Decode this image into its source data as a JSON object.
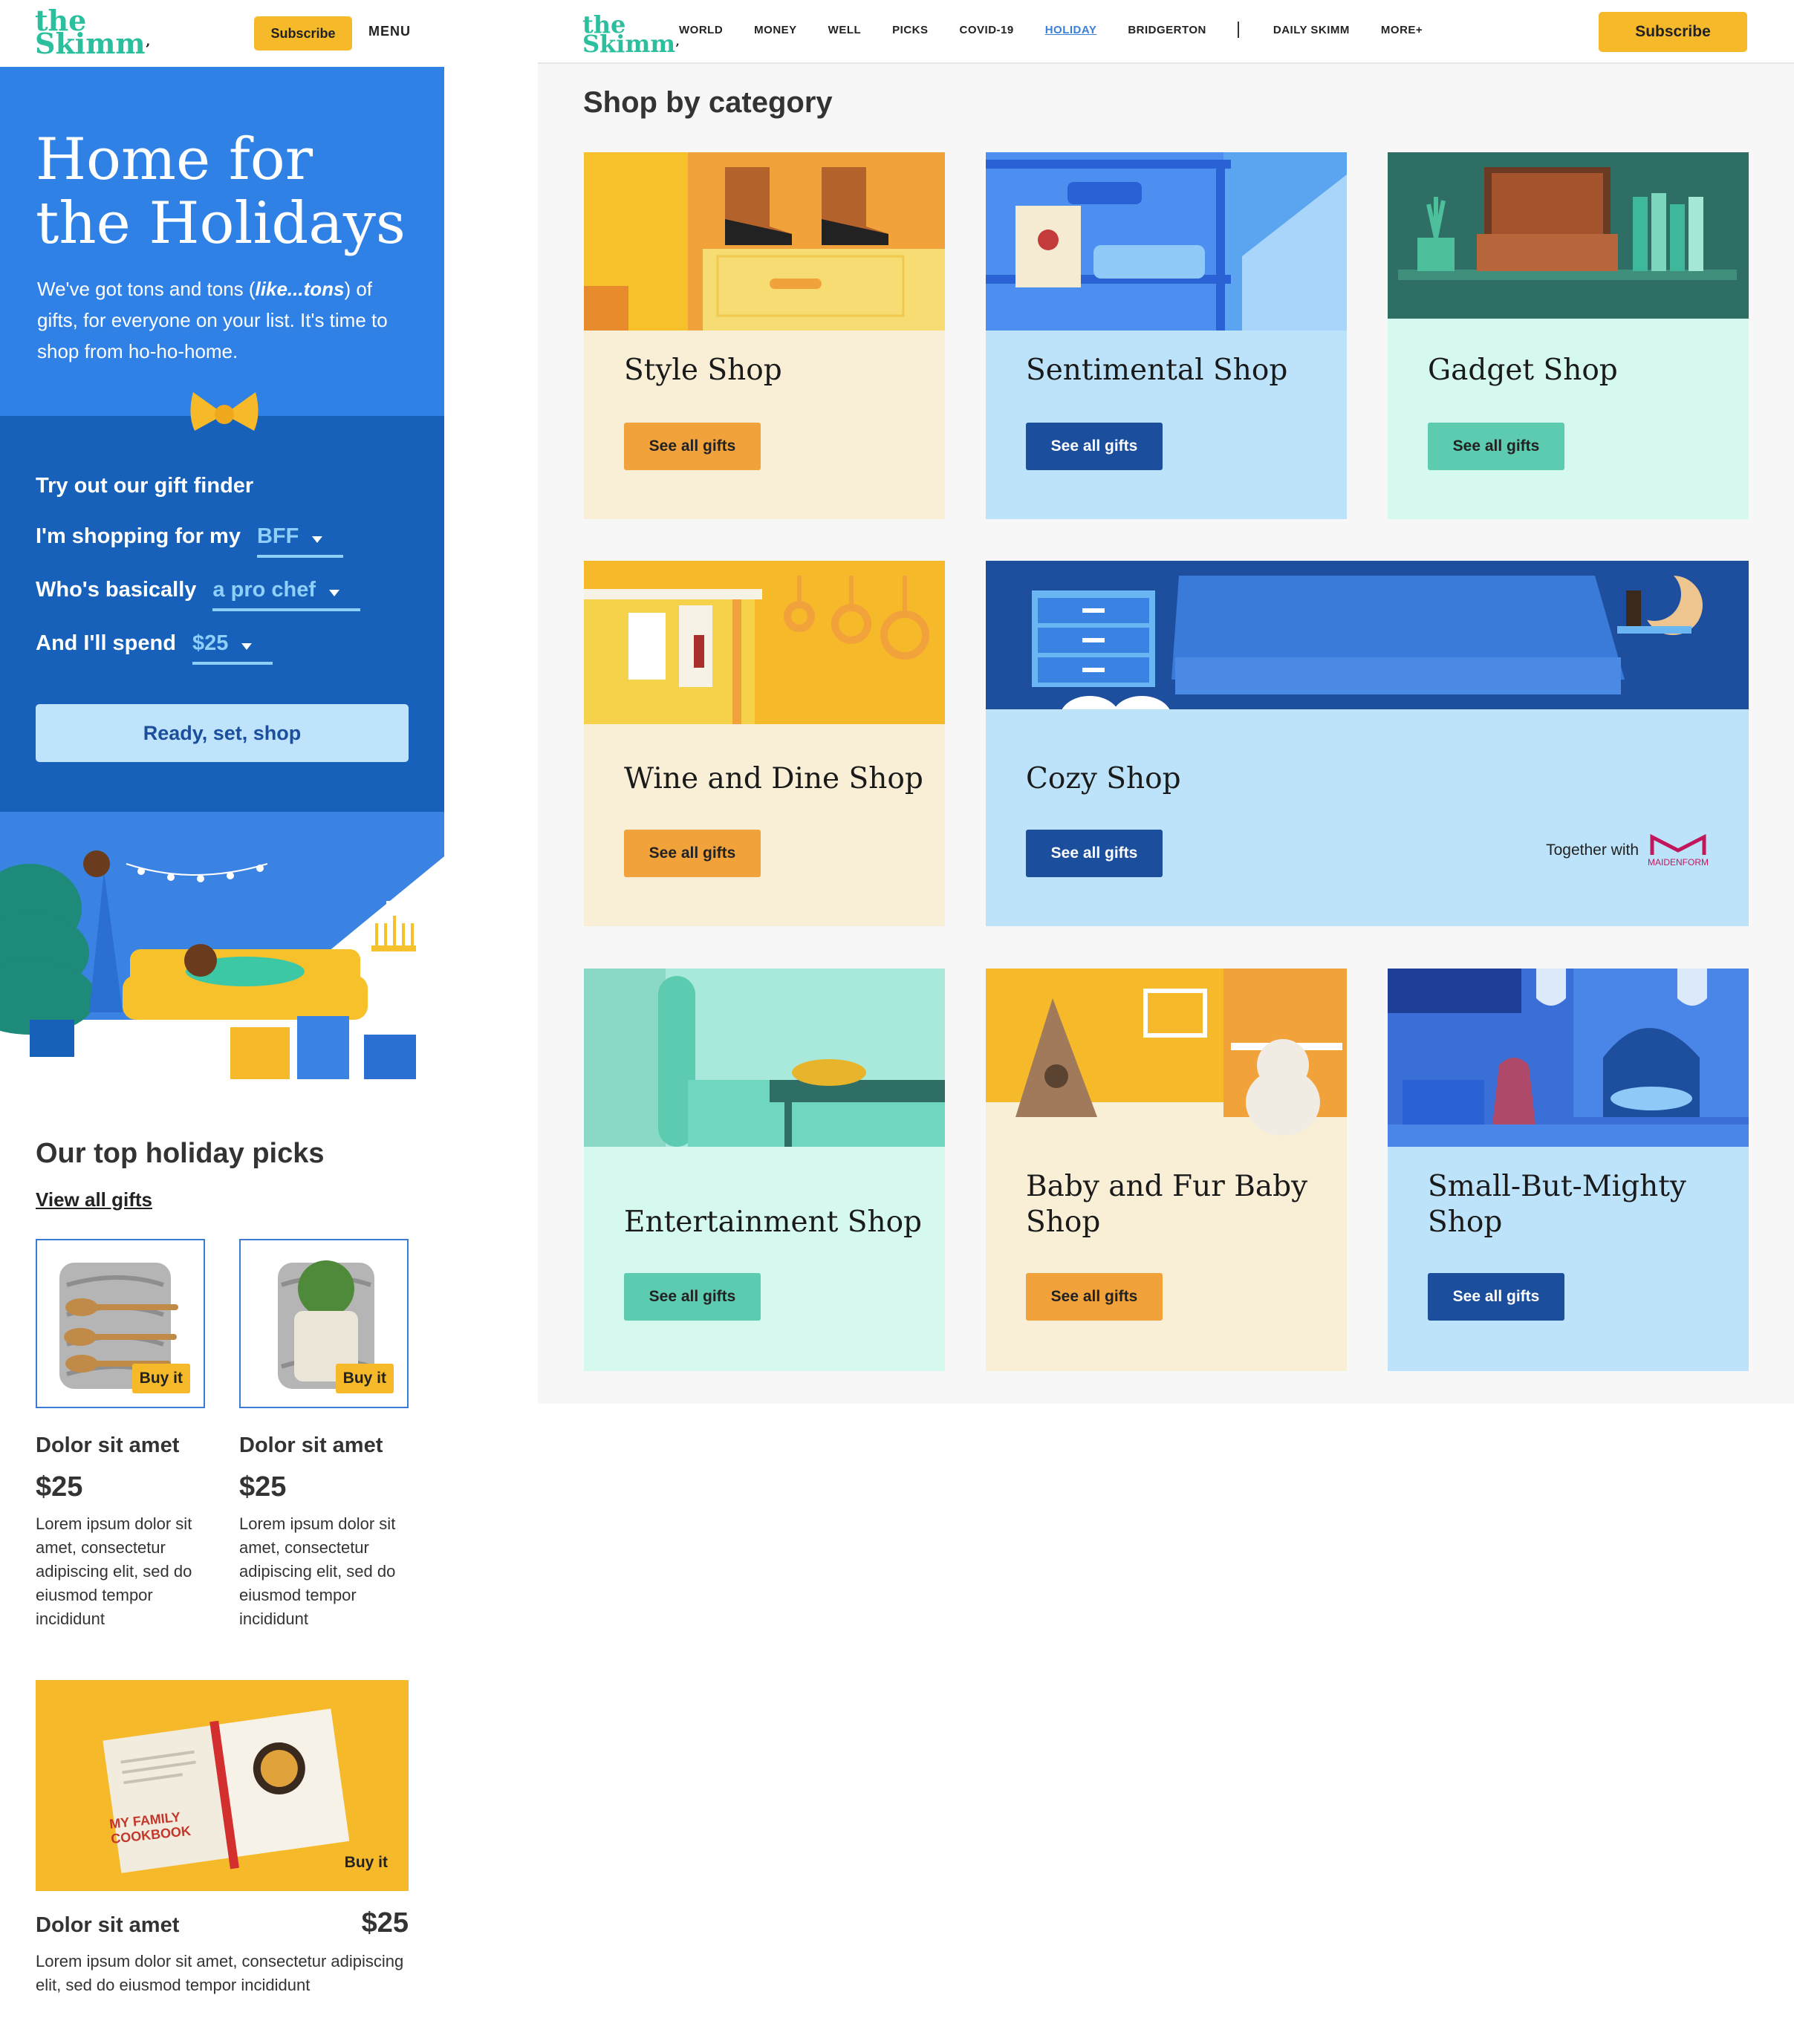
{
  "mobile": {
    "logo": {
      "line1": "the",
      "line2": "Skimm"
    },
    "subscribe_label": "Subscribe",
    "menu_label": "MENU",
    "hero": {
      "title": "Home for the Holidays",
      "intro_before": "We've got tons and tons (",
      "intro_emph": "like...tons",
      "intro_after": ") of gifts, for everyone on your list. It's time to shop from ho-ho-home."
    },
    "finder": {
      "title": "Try out our gift finder",
      "rows": [
        {
          "label": "I'm shopping for my",
          "value": "BFF"
        },
        {
          "label": "Who's basically",
          "value": "a pro chef"
        },
        {
          "label": "And I'll spend",
          "value": "$25"
        }
      ],
      "cta": "Ready, set, shop"
    },
    "picks": {
      "title": "Our top holiday picks",
      "view_all": "View all gifts",
      "buy_label": "Buy it",
      "items": [
        {
          "name": "Dolor sit amet",
          "price": "$25",
          "desc": "Lorem ipsum dolor sit amet, consectetur adipiscing elit, sed do eiusmod tempor incididunt"
        },
        {
          "name": "Dolor sit amet",
          "price": "$25",
          "desc": "Lorem ipsum dolor sit amet, consectetur adipiscing elit, sed do eiusmod tempor incididunt"
        }
      ],
      "featured": {
        "name": "Dolor sit amet",
        "price": "$25",
        "desc": "Lorem ipsum dolor sit amet, consectetur adipiscing elit, sed do eiusmod tempor incididunt",
        "book_line1": "MY FAMILY",
        "book_line2": "COOKBOOK"
      }
    }
  },
  "desktop": {
    "logo": {
      "line1": "the",
      "line2": "Skimm"
    },
    "nav": [
      "WORLD",
      "MONEY",
      "WELL",
      "PICKS",
      "COVID-19",
      "HOLIDAY",
      "BRIDGERTON",
      "DAILY SKIMM",
      "MORE+"
    ],
    "active_nav": "HOLIDAY",
    "subscribe_label": "Subscribe",
    "section_title": "Shop by category",
    "button_label": "See all gifts",
    "sponsor": {
      "text": "Together with",
      "brand": "MAIDENFORM"
    },
    "categories": [
      {
        "title": "Style Shop"
      },
      {
        "title": "Sentimental Shop"
      },
      {
        "title": "Gadget Shop"
      },
      {
        "title": "Wine and Dine Shop"
      },
      {
        "title": "Cozy Shop"
      },
      {
        "title": "Entertainment Shop"
      },
      {
        "title": "Baby and Fur Baby Shop"
      },
      {
        "title": "Small-But-Mighty Shop"
      }
    ]
  },
  "colors": {
    "brand_teal": "#2bbf9e",
    "subscribe_yellow": "#f6b929",
    "hero_blue": "#2f81e6",
    "finder_blue": "#1761ba",
    "btn_orange": "#f2a23b",
    "btn_navy": "#1b4e9c",
    "btn_teal": "#5ccbb0"
  }
}
